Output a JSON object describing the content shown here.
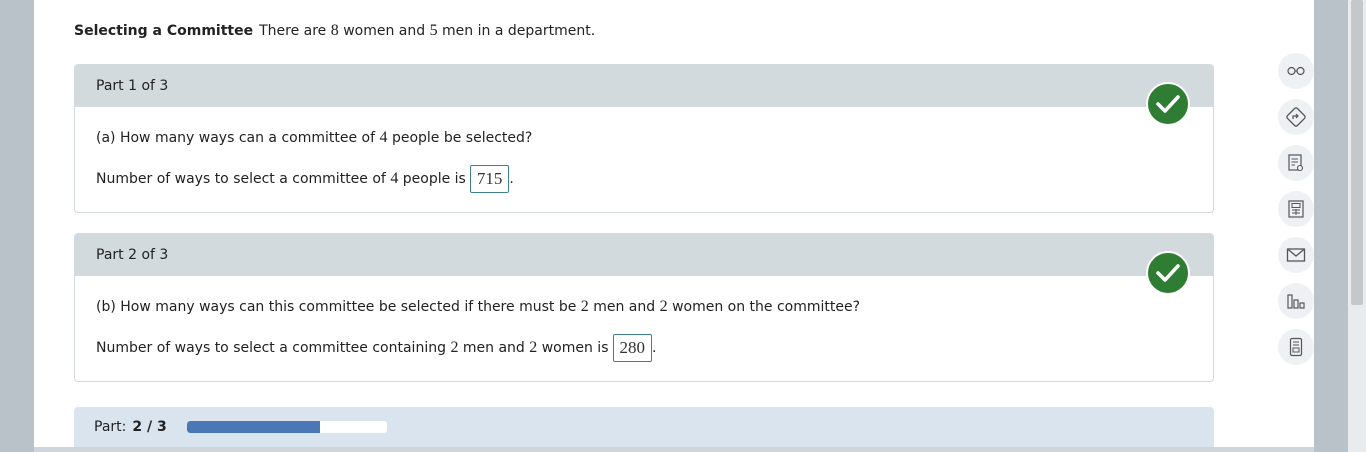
{
  "intro": {
    "title": "Selecting a Committee",
    "text_a": "There are",
    "women_count": "8",
    "text_b": "women and",
    "men_count": "5",
    "text_c": "men in a department."
  },
  "parts": [
    {
      "header": "Part 1 of 3",
      "question_a": "(a) How many ways can a committee of",
      "question_num": "4",
      "question_b": "people be selected?",
      "answer_a": "Number of ways to select a committee of",
      "answer_num": "4",
      "answer_b": "people is",
      "answer_value": "715",
      "answer_end": "."
    },
    {
      "header": "Part 2 of 3",
      "question_a": "(b) How many ways can this committee be selected if there must be",
      "question_num1": "2",
      "question_mid": "men and",
      "question_num2": "2",
      "question_b": "women on the committee?",
      "answer_a": "Number of ways to select a committee containing",
      "answer_num1": "2",
      "answer_mid": "men and",
      "answer_num2": "2",
      "answer_b": "women is",
      "answer_value": "280",
      "answer_end": "."
    }
  ],
  "progress": {
    "label": "Part:",
    "value": "2 / 3",
    "fraction": 0.667
  },
  "tools": [
    "glasses-icon",
    "directions-icon",
    "notes-icon",
    "calculator-icon",
    "mail-icon",
    "chart-icon",
    "phone-icon"
  ],
  "colors": {
    "check": "#2e7d32",
    "progress_fill": "#4a78b5",
    "header_bg": "#d2dade"
  }
}
